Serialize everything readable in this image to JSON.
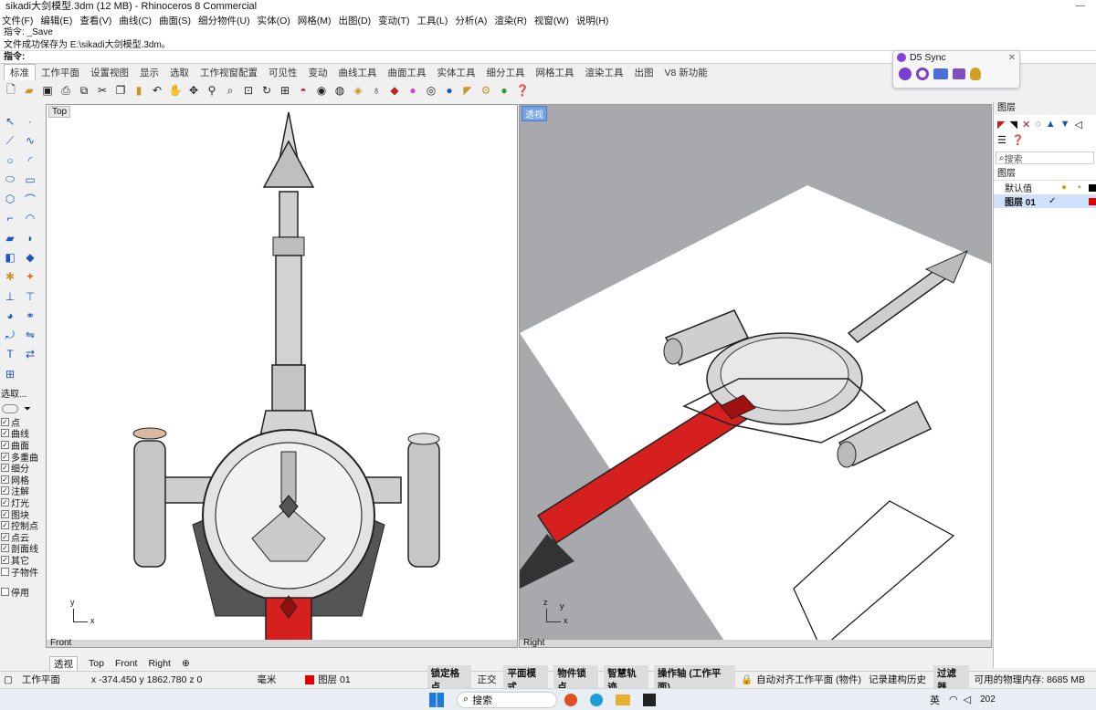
{
  "window": {
    "title": "sikadi大剑模型.3dm (12 MB) - Rhinoceros 8 Commercial",
    "controls": "—"
  },
  "menu": [
    "文件(F)",
    "编辑(E)",
    "查看(V)",
    "曲线(C)",
    "曲面(S)",
    "细分物件(U)",
    "实体(O)",
    "网格(M)",
    "出图(D)",
    "变动(T)",
    "工具(L)",
    "分析(A)",
    "渲染(R)",
    "视窗(W)",
    "说明(H)"
  ],
  "command": {
    "history_line1": "指令: _Save",
    "history_line2": "文件成功保存为 E:\\sikadi大剑模型.3dm。",
    "prompt": "指令:"
  },
  "ribbon_tabs": [
    "标准",
    "工作平面",
    "设置视图",
    "显示",
    "选取",
    "工作视窗配置",
    "可见性",
    "变动",
    "曲线工具",
    "曲面工具",
    "实体工具",
    "细分工具",
    "网格工具",
    "渲染工具",
    "出图",
    "V8 新功能"
  ],
  "toolbar_icons": [
    "new-file-icon",
    "open-folder-icon",
    "save-icon",
    "print-icon",
    "import-icon",
    "cut-icon",
    "copy-icon",
    "paste-icon",
    "undo-icon",
    "pan-hand-icon",
    "rotate-view-icon",
    "zoom-icon",
    "zoom-window-icon",
    "zoom-extents-icon",
    "reset-view-icon",
    "grid-4-viewports-icon",
    "car-icon",
    "eye-icon",
    "sphere-icon",
    "toggle-icon",
    "light-bulb-icon",
    "materials-icon",
    "render-color-icon",
    "globe-icon",
    "sphere-blue-icon",
    "pin-icon",
    "settings-gear-icon",
    "green-ball-icon",
    "help-icon"
  ],
  "selection_filter": {
    "title": "选取...",
    "items": [
      {
        "label": "点",
        "checked": true
      },
      {
        "label": "曲线",
        "checked": true
      },
      {
        "label": "曲面",
        "checked": true
      },
      {
        "label": "多重曲",
        "checked": true
      },
      {
        "label": "细分",
        "checked": true
      },
      {
        "label": "网格",
        "checked": true
      },
      {
        "label": "注解",
        "checked": true
      },
      {
        "label": "灯光",
        "checked": true
      },
      {
        "label": "图块",
        "checked": true
      },
      {
        "label": "控制点",
        "checked": true
      },
      {
        "label": "点云",
        "checked": true
      },
      {
        "label": "剖面线",
        "checked": true
      },
      {
        "label": "其它",
        "checked": true
      },
      {
        "label": "子物件",
        "checked": false
      }
    ],
    "disable_label": "停用"
  },
  "viewports": {
    "top": {
      "label": "Top",
      "axis_x": "x",
      "axis_y": "y",
      "bottom_tab": "Front"
    },
    "perspective": {
      "label": "透视",
      "axis_x": "x",
      "axis_y": "y",
      "axis_z": "z",
      "bottom_tab": "Right"
    }
  },
  "viewport_tabs": [
    "透视",
    "Top",
    "Front",
    "Right",
    "⊕"
  ],
  "statusbar": {
    "plane": "工作平面",
    "coords": "x -374.450  y 1862.780  z 0",
    "units": "毫米",
    "layer": "图层 01",
    "layer_color": "#e00000",
    "toggles": [
      "锁定格点",
      "正交",
      "平面模式",
      "物件锁点",
      "智慧轨迹",
      "操作轴 (工作平面)"
    ],
    "toggles_on": [
      true,
      false,
      true,
      true,
      true,
      true
    ],
    "auto_align": "自动对齐工作平面 (物件)",
    "record_history": "记录建构历史",
    "filter": "过滤器",
    "memory": "可用的物理内存: 8685 MB"
  },
  "layers_panel": {
    "title": "图层",
    "search_placeholder": "搜索",
    "header": "图层",
    "rows": [
      {
        "name": "默认值",
        "current": false,
        "color": "#000000"
      },
      {
        "name": "图层 01",
        "current": true,
        "color": "#e00000",
        "check": "✓"
      }
    ]
  },
  "d5": {
    "title": "D5 Sync"
  },
  "taskbar": {
    "search": "搜索",
    "ime": "英",
    "time": "202"
  },
  "colors": {
    "accent": "#6fa0e8",
    "blade_red": "#d62020",
    "viewport_bg": "#ffffff",
    "persp_bg": "#a7a9ad"
  }
}
